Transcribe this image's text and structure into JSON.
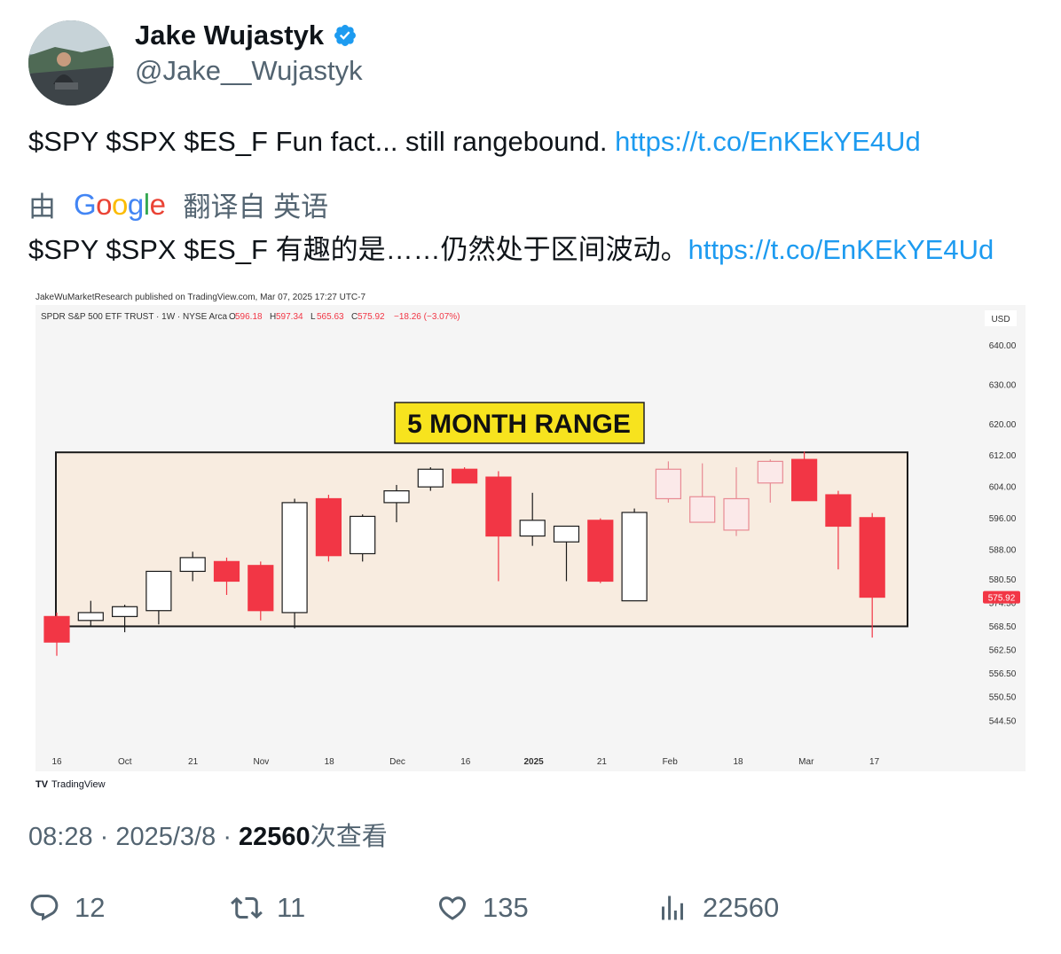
{
  "author": {
    "name": "Jake Wujastyk",
    "handle": "@Jake__Wujastyk",
    "verified": true
  },
  "tweet": {
    "text": "$SPY $SPX $ES_F Fun fact... still rangebound.",
    "link": "https://t.co/EnKEkYE4Ud"
  },
  "translation": {
    "by_label": "由",
    "provider": "Google",
    "from_label": "翻译自 英语",
    "text": "$SPY $SPX $ES_F 有趣的是……仍然处于区间波动。",
    "link": "https://t.co/EnKEkYE4Ud"
  },
  "chart_data": {
    "type": "candlestick",
    "publisher_line": "JakeWuMarketResearch published on TradingView.com, Mar 07, 2025 17:27 UTC-7",
    "symbol_line": "SPDR S&P 500 ETF TRUST · 1W · NYSE Arca",
    "ohlc_readout": {
      "O": "596.18",
      "H": "597.34",
      "L": "565.63",
      "C": "575.92",
      "change": "−18.26 (−3.07%)"
    },
    "currency": "USD",
    "annotation": "5 MONTH RANGE",
    "last_price": "575.92",
    "footer_brand": "TradingView",
    "y_ticks": [
      "640.00",
      "630.00",
      "620.00",
      "612.00",
      "604.00",
      "596.00",
      "588.00",
      "580.50",
      "574.50",
      "568.50",
      "562.50",
      "556.50",
      "550.50",
      "544.50"
    ],
    "x_ticks": [
      "16",
      "Oct",
      "21",
      "Nov",
      "18",
      "Dec",
      "16",
      "2025",
      "21",
      "Feb",
      "18",
      "Mar",
      "17"
    ],
    "range_box": {
      "low": 568.5,
      "high": 612.8
    },
    "candles": [
      {
        "o": 571.0,
        "h": 572.0,
        "l": 561.0,
        "c": 564.5
      },
      {
        "o": 570.0,
        "h": 575.0,
        "l": 568.5,
        "c": 572.0
      },
      {
        "o": 571.0,
        "h": 574.0,
        "l": 567.0,
        "c": 573.5
      },
      {
        "o": 572.5,
        "h": 580.5,
        "l": 569.0,
        "c": 582.5
      },
      {
        "o": 582.5,
        "h": 587.5,
        "l": 580.0,
        "c": 586.0
      },
      {
        "o": 585.0,
        "h": 586.0,
        "l": 576.5,
        "c": 580.0
      },
      {
        "o": 584.0,
        "h": 585.0,
        "l": 570.0,
        "c": 572.5
      },
      {
        "o": 572.0,
        "h": 601.0,
        "l": 568.0,
        "c": 600.0
      },
      {
        "o": 601.0,
        "h": 602.0,
        "l": 585.0,
        "c": 586.5
      },
      {
        "o": 587.0,
        "h": 597.0,
        "l": 585.0,
        "c": 596.5
      },
      {
        "o": 600.0,
        "h": 604.5,
        "l": 595.0,
        "c": 603.0
      },
      {
        "o": 604.0,
        "h": 609.0,
        "l": 603.0,
        "c": 608.5
      },
      {
        "o": 608.5,
        "h": 609.0,
        "l": 605.0,
        "c": 605.0
      },
      {
        "o": 606.5,
        "h": 608.0,
        "l": 580.0,
        "c": 591.5
      },
      {
        "o": 591.5,
        "h": 602.5,
        "l": 589.0,
        "c": 595.5
      },
      {
        "o": 590.0,
        "h": 592.0,
        "l": 580.0,
        "c": 594.0
      },
      {
        "o": 595.5,
        "h": 596.0,
        "l": 579.5,
        "c": 580.0
      },
      {
        "o": 575.0,
        "h": 598.5,
        "l": 575.0,
        "c": 597.5
      },
      {
        "o": 601.0,
        "h": 610.5,
        "l": 600.0,
        "c": 608.5
      },
      {
        "o": 595.0,
        "h": 610.0,
        "l": 595.0,
        "c": 601.5
      },
      {
        "o": 593.0,
        "h": 609.0,
        "l": 591.5,
        "c": 601.0
      },
      {
        "o": 605.0,
        "h": 611.0,
        "l": 600.0,
        "c": 610.5
      },
      {
        "o": 611.0,
        "h": 613.0,
        "l": 600.5,
        "c": 600.5
      },
      {
        "o": 602.0,
        "h": 603.0,
        "l": 583.0,
        "c": 594.0
      },
      {
        "o": 596.18,
        "h": 597.34,
        "l": 565.63,
        "c": 575.92
      }
    ]
  },
  "meta": {
    "time": "08:28",
    "date": "2025/3/8",
    "views": "22560",
    "views_label": "次查看"
  },
  "actions": {
    "replies": "12",
    "retweets": "11",
    "likes": "135",
    "views": "22560"
  },
  "colors": {
    "link": "#1d9bf0",
    "bull": "#ffffff",
    "bear": "#f23645",
    "range_fill": "#f8ece0",
    "annotation_bg": "#f7e31e"
  }
}
